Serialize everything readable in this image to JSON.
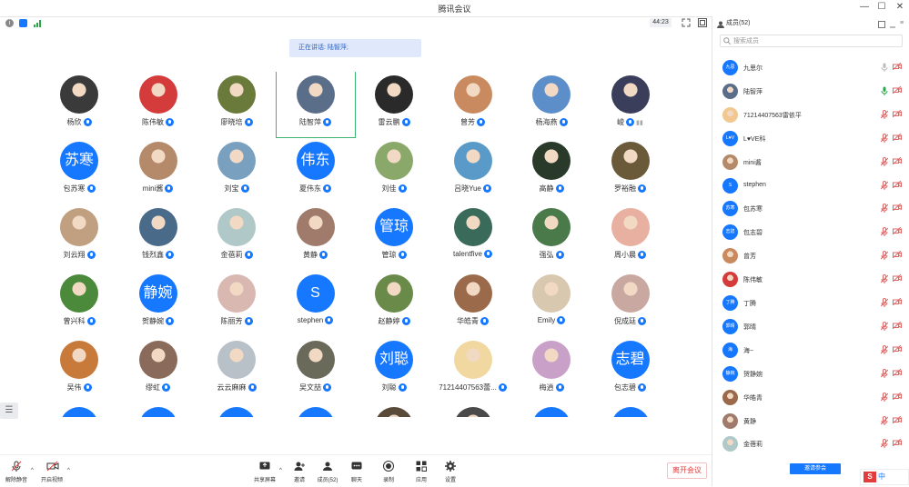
{
  "app": {
    "title": "腾讯会议",
    "window_controls": [
      "—",
      "☐",
      "✕"
    ]
  },
  "topbar": {
    "clock": "44:23"
  },
  "speaking": {
    "label": "正在讲话: 陆智萍;"
  },
  "participants_grid": [
    {
      "name": "杨欣",
      "avatar": "photo",
      "color": "#3a3a3a"
    },
    {
      "name": "陈伟敏",
      "avatar": "photo",
      "color": "#d43c3c"
    },
    {
      "name": "廖晓培",
      "avatar": "photo",
      "color": "#6a7a3a"
    },
    {
      "name": "陆智萍",
      "avatar": "photo",
      "color": "#5a6e8a",
      "active": true
    },
    {
      "name": "雷云鹏",
      "avatar": "photo",
      "color": "#2a2a2a"
    },
    {
      "name": "曾芳",
      "avatar": "photo",
      "color": "#c98a60"
    },
    {
      "name": "杨海燕",
      "avatar": "photo",
      "color": "#5c8fc9"
    },
    {
      "name": "峻",
      "avatar": "photo",
      "color": "#3a3e5a",
      "bars": true
    },
    {
      "name": "包苏寒",
      "avatar": "text",
      "text": "苏寒"
    },
    {
      "name": "mini酱",
      "avatar": "photo",
      "color": "#b58a6a"
    },
    {
      "name": "刘宝",
      "avatar": "photo",
      "color": "#7aa0c0"
    },
    {
      "name": "夏伟东",
      "avatar": "text",
      "text": "伟东"
    },
    {
      "name": "刘佳",
      "avatar": "photo",
      "color": "#8aa86a"
    },
    {
      "name": "吕晓Yue",
      "avatar": "photo",
      "color": "#5a9ac9"
    },
    {
      "name": "高静",
      "avatar": "photo",
      "color": "#2a3a2a"
    },
    {
      "name": "罗裕融",
      "avatar": "photo",
      "color": "#6a5a3a"
    },
    {
      "name": "刘云翔",
      "avatar": "photo",
      "color": "#c0a080"
    },
    {
      "name": "钱烈鑫",
      "avatar": "photo",
      "color": "#4a6a8a"
    },
    {
      "name": "金蓓莉",
      "avatar": "photo",
      "color": "#b0c8c8"
    },
    {
      "name": "黄静",
      "avatar": "photo",
      "color": "#a07a6a"
    },
    {
      "name": "管琼",
      "avatar": "text",
      "text": "管琼"
    },
    {
      "name": "talentfive",
      "avatar": "photo",
      "color": "#3a6a5a"
    },
    {
      "name": "强弘",
      "avatar": "photo",
      "color": "#4a7a4a"
    },
    {
      "name": "周小晨",
      "avatar": "photo",
      "color": "#e8b0a0"
    },
    {
      "name": "曾兴科",
      "avatar": "photo",
      "color": "#4a8a3a"
    },
    {
      "name": "贺静婉",
      "avatar": "text",
      "text": "静婉"
    },
    {
      "name": "陈丽芳",
      "avatar": "photo",
      "color": "#d8b8b0"
    },
    {
      "name": "stephen",
      "avatar": "text",
      "text": "S"
    },
    {
      "name": "赵静婷",
      "avatar": "photo",
      "color": "#6a8a4a"
    },
    {
      "name": "华皓青",
      "avatar": "photo",
      "color": "#9a6a4a"
    },
    {
      "name": "Emily",
      "avatar": "photo",
      "color": "#d8c8b0"
    },
    {
      "name": "倪成廷",
      "avatar": "photo",
      "color": "#c8a8a0"
    },
    {
      "name": "吴伟",
      "avatar": "photo",
      "color": "#c87a3a"
    },
    {
      "name": "缪虹",
      "avatar": "photo",
      "color": "#8a6a5a"
    },
    {
      "name": "云云麻麻",
      "avatar": "photo",
      "color": "#b8c0c8"
    },
    {
      "name": "吴文喆",
      "avatar": "photo",
      "color": "#6a6a5a"
    },
    {
      "name": "刘聪",
      "avatar": "text",
      "text": "刘聪"
    },
    {
      "name": "71214407563蕾...",
      "avatar": "photo",
      "color": "#f0d8a0"
    },
    {
      "name": "梅逍",
      "avatar": "photo",
      "color": "#c8a0c8"
    },
    {
      "name": "包志碧",
      "avatar": "text",
      "text": "志碧"
    },
    {
      "name": "",
      "avatar": "text",
      "text": ""
    },
    {
      "name": "",
      "avatar": "text",
      "text": ""
    },
    {
      "name": "",
      "avatar": "text",
      "text": ""
    },
    {
      "name": "",
      "avatar": "text",
      "text": ""
    },
    {
      "name": "",
      "avatar": "photo",
      "color": "#5a4a3a"
    },
    {
      "name": "",
      "avatar": "photo",
      "color": "#4a4a4a"
    },
    {
      "name": "",
      "avatar": "text",
      "text": ""
    },
    {
      "name": "",
      "avatar": "text",
      "text": ""
    }
  ],
  "toolbar": {
    "mute": "解除静音",
    "video": "开启视频",
    "share": "共享屏幕",
    "invite": "邀请",
    "members": "成员(52)",
    "chat": "聊天",
    "record": "录制",
    "apps": "应用",
    "settings": "设置",
    "leave": "离开会议"
  },
  "panel": {
    "title": "成员(52)",
    "search_placeholder": "搜索成员",
    "invite_button": "邀请参会",
    "members": [
      {
        "name": "九思尔",
        "avatar": "text",
        "text": "九思",
        "mic": "gray"
      },
      {
        "name": "陆智萍",
        "avatar": "photo",
        "color": "#5a6e8a",
        "mic": "green"
      },
      {
        "name": "71214407563雷依平",
        "avatar": "photo",
        "color": "#f0c890",
        "mic": "muted"
      },
      {
        "name": "L♥VE科",
        "avatar": "text",
        "text": "L♥V",
        "mic": "muted"
      },
      {
        "name": "mini酱",
        "avatar": "photo",
        "color": "#b58a6a",
        "mic": "muted"
      },
      {
        "name": "stephen",
        "avatar": "text",
        "text": "S",
        "mic": "muted"
      },
      {
        "name": "包苏寒",
        "avatar": "text",
        "text": "苏寒",
        "mic": "muted"
      },
      {
        "name": "包志碧",
        "avatar": "text",
        "text": "志碧",
        "mic": "muted"
      },
      {
        "name": "曾芳",
        "avatar": "photo",
        "color": "#c98a60",
        "mic": "muted"
      },
      {
        "name": "陈伟敏",
        "avatar": "photo",
        "color": "#d43c3c",
        "mic": "muted"
      },
      {
        "name": "丁腾",
        "avatar": "text",
        "text": "丁腾",
        "mic": "muted"
      },
      {
        "name": "郭晴",
        "avatar": "text",
        "text": "郭晴",
        "mic": "muted"
      },
      {
        "name": "海~",
        "avatar": "text",
        "text": "海",
        "mic": "muted"
      },
      {
        "name": "贺静婉",
        "avatar": "text",
        "text": "静婉",
        "mic": "muted"
      },
      {
        "name": "华皓青",
        "avatar": "photo",
        "color": "#9a6a4a",
        "mic": "muted"
      },
      {
        "name": "黄静",
        "avatar": "photo",
        "color": "#a07a6a",
        "mic": "muted"
      },
      {
        "name": "金蓓莉",
        "avatar": "photo",
        "color": "#b0c8c8",
        "mic": "muted"
      }
    ]
  },
  "ime": {
    "logo": "S",
    "lang": "中"
  },
  "colors": {
    "accent": "#1677ff",
    "danger": "#e23c3c",
    "active": "#3cb371"
  }
}
